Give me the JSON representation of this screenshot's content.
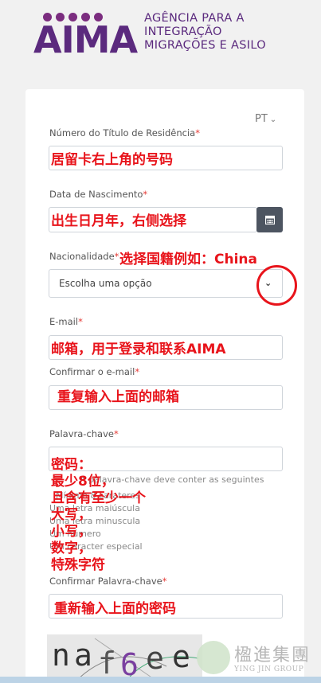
{
  "logo": {
    "word": "AIMA",
    "line1": "AGÊNCIA PARA A",
    "line2": "INTEGRAÇÃO",
    "line3": "MIGRAÇÕES E ASILO"
  },
  "language": {
    "selected": "PT"
  },
  "form": {
    "residence_title_number": {
      "label": "Número do Título de Residência",
      "required_mark": "*",
      "annotation": "居留卡右上角的号码"
    },
    "birth_date": {
      "label": "Data de Nascimento",
      "required_mark": "*",
      "annotation": "出生日月年，右侧选择"
    },
    "nationality": {
      "label": "Nacionalidade",
      "required_mark": "*",
      "annotation": "选择国籍例如：China",
      "selected": "Escolha uma opção"
    },
    "email": {
      "label": "E-mail",
      "required_mark": "*",
      "annotation": "邮箱，用于登录和联系AIMA"
    },
    "confirm_email": {
      "label": "Confirmar o e-mail",
      "required_mark": "*",
      "annotation": "重复输入上面的邮箱"
    },
    "password": {
      "label": "Palavra-chave",
      "required_mark": "*",
      "annotation_lines": [
        "密码：",
        "最少8位，",
        "且含有至少一个",
        "大写，",
        "小写，",
        "数字，",
        "特殊字符"
      ],
      "hints": [
        "A palavra-chave deve conter as seguintes",
        "Mínimo 8 carateres",
        "Uma letra maiúscula",
        "Uma letra minuscula",
        "Um número",
        "Um caracter especial"
      ]
    },
    "confirm_password": {
      "label": "Confirmar Palavra-chave",
      "required_mark": "*",
      "annotation": "重新输入上面的密码"
    }
  },
  "captcha": {
    "text": "naf6ee"
  },
  "watermark": {
    "name": "楹進集團",
    "sub": "YING JIN GROUP"
  },
  "colors": {
    "brand": "#5b2a7e",
    "annotation": "#e8141b",
    "date_button": "#4d5561"
  },
  "icons": {
    "date": "calendar-icon",
    "select": "chevron-down-icon"
  }
}
